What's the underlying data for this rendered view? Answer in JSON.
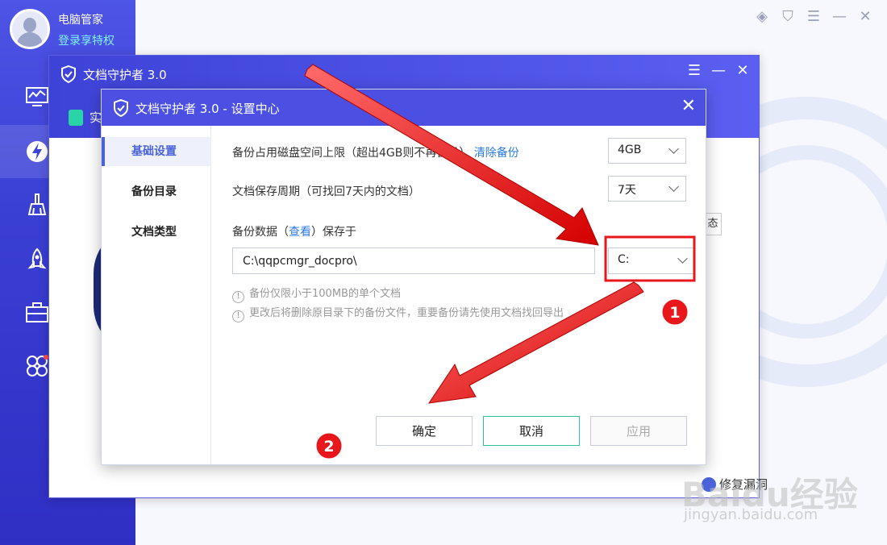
{
  "app": {
    "name": "电脑管家",
    "login": "登录享特权"
  },
  "top_controls": [
    "◈",
    "⛉",
    "☰",
    "—",
    "✕"
  ],
  "outer_window": {
    "title": "文档守护者 3.0",
    "tab_label": "实",
    "status_btn": "态",
    "controls": [
      "☰",
      "—",
      "✕"
    ],
    "footer_text": "修复漏洞"
  },
  "dialog": {
    "title": "文档守护者 3.0 - 设置中心",
    "close": "✕",
    "sidebar": [
      {
        "label": "基础设置",
        "active": true
      },
      {
        "label": "备份目录",
        "active": false
      },
      {
        "label": "文档类型",
        "active": false
      }
    ],
    "disk_limit": {
      "label": "备份占用磁盘空间上限（超出4GB则不再备份）",
      "link": "清除备份",
      "value": "4GB"
    },
    "retention": {
      "label": "文档保存周期（可找回7天内的文档）",
      "value": "7天"
    },
    "backup_location": {
      "label_prefix": "备份数据（",
      "link": "查看",
      "label_suffix": "）保存于",
      "path": "C:\\qqpcmgr_docpro\\",
      "drive": "C:"
    },
    "notes": [
      "备份仅限小于100MB的单个文档",
      "更改后将删除原目录下的备份文件，重要备份请先使用文档找回导出"
    ],
    "buttons": {
      "ok": "确定",
      "cancel": "取消",
      "apply": "应用"
    }
  },
  "annotations": {
    "marker_1": "1",
    "marker_2": "2",
    "highlight_color": "#e8171b"
  },
  "watermark": {
    "main": "Baidu经验",
    "sub": "jingyan.baidu.com"
  }
}
